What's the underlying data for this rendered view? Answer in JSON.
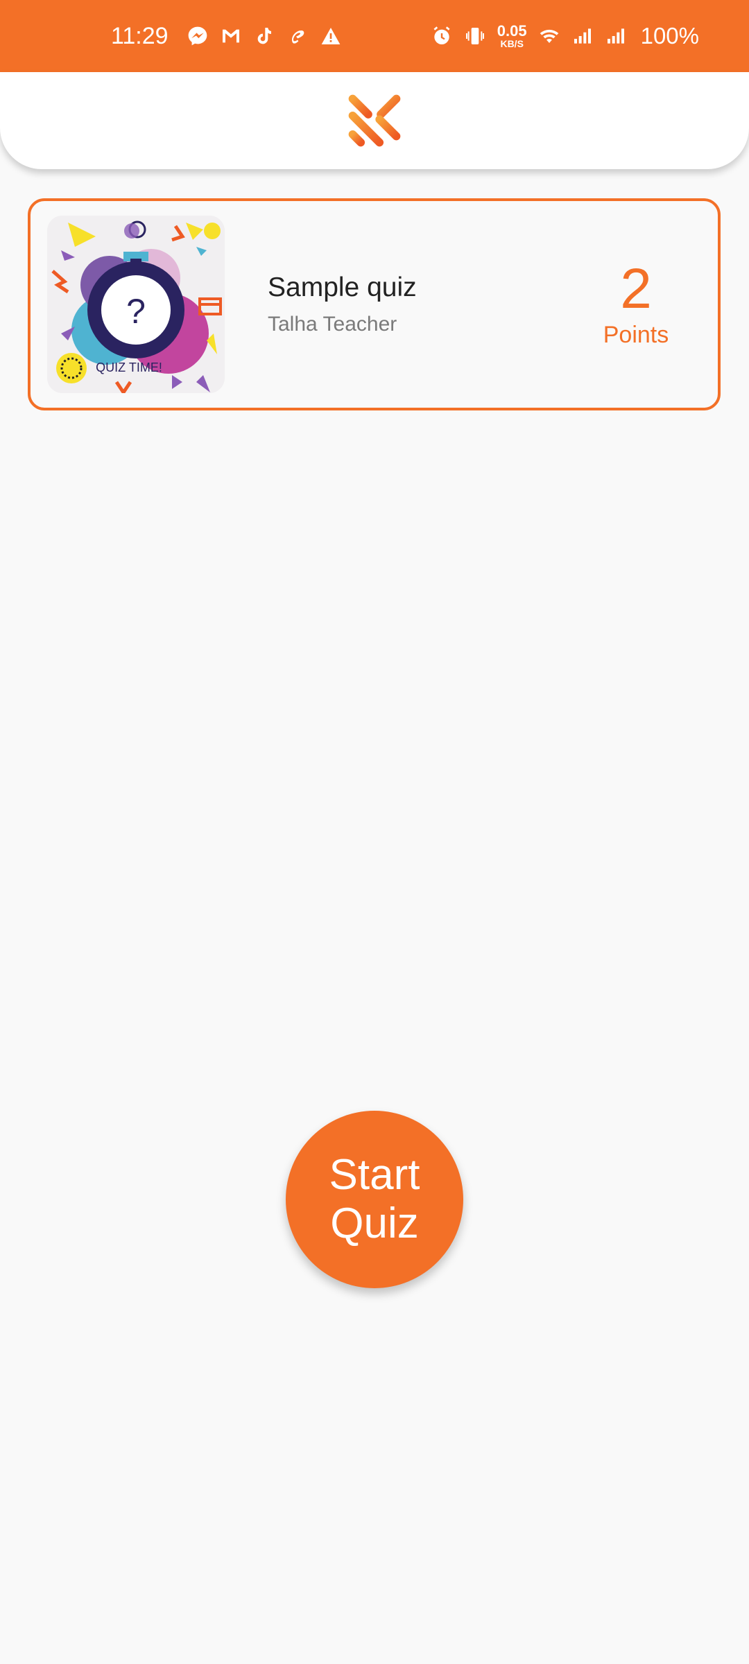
{
  "status_bar": {
    "time": "11:29",
    "net_speed_value": "0.05",
    "net_speed_unit": "KB/S",
    "battery": "100%",
    "background": "#f37027",
    "left_icons": [
      "messenger-icon",
      "gmail-icon",
      "tiktok-icon",
      "airtel-icon",
      "warning-icon"
    ],
    "right_icons": [
      "alarm-icon",
      "vibrate-icon",
      "wifi-icon",
      "signal-icon",
      "signal-icon"
    ]
  },
  "header": {
    "logo": "app-logo-icon"
  },
  "quiz_card": {
    "thumbnail_text": "QUIZ TIME!",
    "thumbnail_symbol": "?",
    "title": "Sample quiz",
    "author": "Talha Teacher",
    "points_value": "2",
    "points_label": "Points"
  },
  "start_button": {
    "line1": "Start",
    "line2": "Quiz"
  },
  "colors": {
    "accent": "#f37027",
    "background": "#f9f9f9"
  }
}
